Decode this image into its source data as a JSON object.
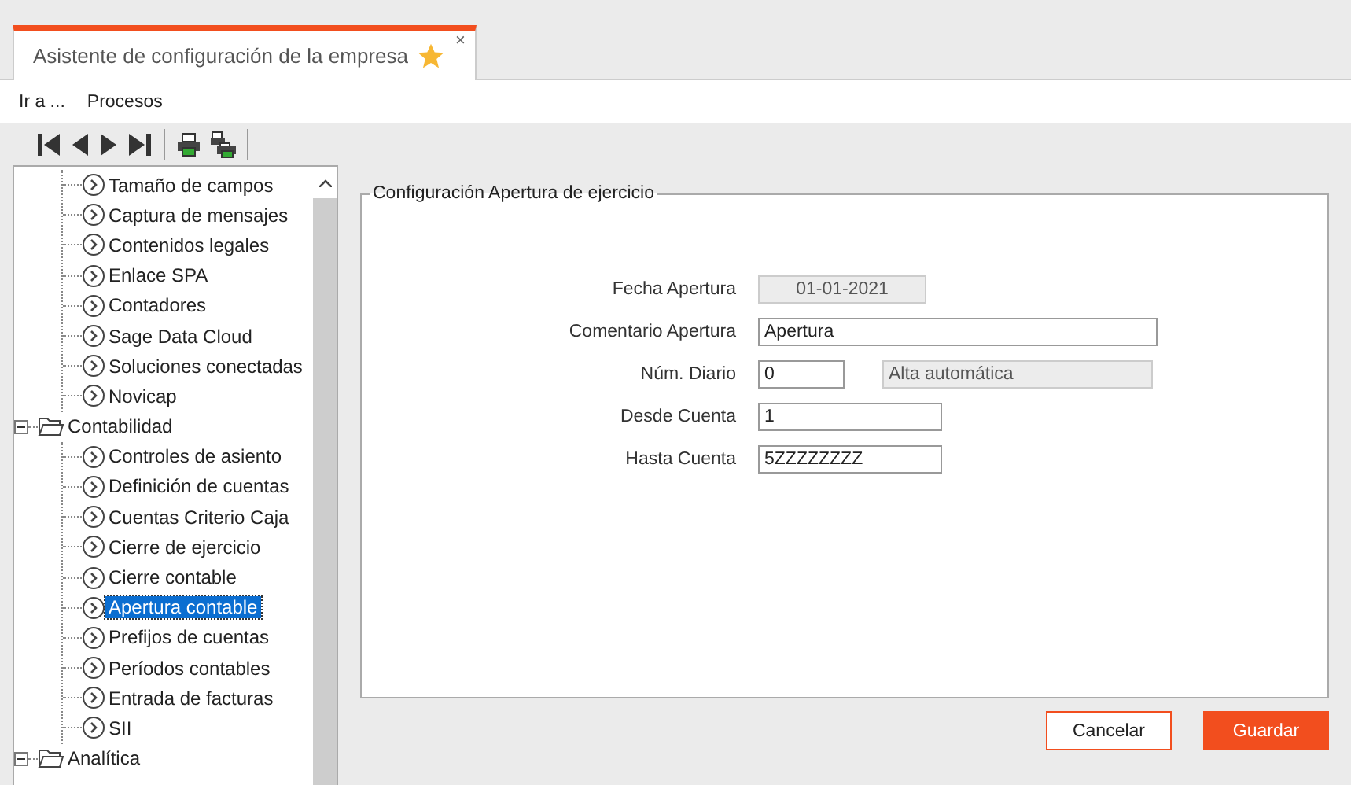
{
  "window": {
    "tab": {
      "title": "Asistente de configuración de la empresa",
      "favorite": true,
      "close": "×"
    }
  },
  "menu": [
    {
      "label": "Ir a ..."
    },
    {
      "label": "Procesos"
    }
  ],
  "tree": [
    {
      "children": [
        {
          "label": "Tamaño de campos",
          "selected": false
        },
        {
          "label": "Captura de mensajes",
          "selected": false
        },
        {
          "label": "Contenidos legales",
          "selected": false
        },
        {
          "label": "Enlace SPA",
          "selected": false
        },
        {
          "label": "Contadores",
          "selected": false
        },
        {
          "label": "Sage Data Cloud",
          "selected": false
        },
        {
          "label": "Soluciones conectadas",
          "selected": false
        },
        {
          "label": "Novicap",
          "selected": false
        }
      ]
    },
    {
      "label": "Contabilidad",
      "expanded": true,
      "children": [
        {
          "label": "Controles de asiento",
          "selected": false
        },
        {
          "label": "Definición de cuentas",
          "selected": false
        },
        {
          "label": "Cuentas Criterio Caja",
          "selected": false
        },
        {
          "label": "Cierre de ejercicio",
          "selected": false
        },
        {
          "label": "Cierre contable",
          "selected": false
        },
        {
          "label": "Apertura contable",
          "selected": true
        },
        {
          "label": "Prefijos de cuentas",
          "selected": false
        },
        {
          "label": "Períodos contables",
          "selected": false
        },
        {
          "label": "Entrada de facturas",
          "selected": false
        },
        {
          "label": "SII",
          "selected": false
        }
      ]
    },
    {
      "label": "Analítica",
      "expanded": true
    }
  ],
  "form": {
    "title": "Configuración Apertura de ejercicio",
    "fields": [
      {
        "label": "Fecha Apertura",
        "value": "01-01-2021",
        "disabled": true
      },
      {
        "label": "Comentario Apertura",
        "value": "Apertura",
        "disabled": false
      },
      {
        "label": "Núm. Diario",
        "value": "0",
        "disabled": false,
        "extra": "Alta automática"
      },
      {
        "label": "Desde Cuenta",
        "value": "1",
        "disabled": false
      },
      {
        "label": "Hasta Cuenta",
        "value": "5ZZZZZZZZ",
        "disabled": false
      }
    ]
  },
  "buttons": [
    {
      "label": "Cancelar",
      "kind": "secondary"
    },
    {
      "label": "Guardar",
      "kind": "primary"
    }
  ]
}
